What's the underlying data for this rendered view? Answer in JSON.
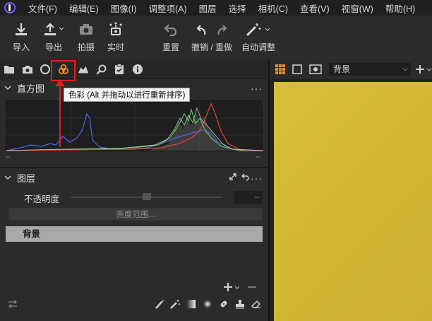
{
  "menubar": {
    "items": [
      "文件(F)",
      "编辑(E)",
      "图像(I)",
      "调整项(A)",
      "图层",
      "选择",
      "相机(C)",
      "查看(V)",
      "视窗(W)",
      "帮助(H)"
    ]
  },
  "toolbar": {
    "import": {
      "label": "导入",
      "icon": "import-icon"
    },
    "export": {
      "label": "导出",
      "icon": "export-icon"
    },
    "capture": {
      "label": "拍摄",
      "icon": "camera-icon"
    },
    "live": {
      "label": "实时",
      "icon": "live-view-icon"
    },
    "reset": {
      "label": "重置",
      "icon": "reset-icon"
    },
    "undo_redo": {
      "label": "撤销 / 重做",
      "icon": "undo-redo-icon"
    },
    "auto_adjust": {
      "label": "自动调整",
      "icon": "magic-wand-icon"
    }
  },
  "tool_tabs": {
    "icons": [
      "folder-icon",
      "camera-icon",
      "lens-icon",
      "color-icon",
      "exposure-icon",
      "search-icon",
      "clipboard-icon",
      "info-icon"
    ],
    "active": "color-icon",
    "tooltip": "色彩 (Alt 并拖动以进行重新排序)"
  },
  "histogram": {
    "title": "直方图",
    "foot_left": "--",
    "foot_right": "--",
    "colors": {
      "red": "#e0413a",
      "green": "#5fc35a",
      "blue": "#5a62e8",
      "luma": "#d9d9d9"
    }
  },
  "layers": {
    "title": "图层",
    "opacity_label": "不透明度",
    "opacity_value": "--",
    "range_button": "亮度范围...",
    "layer_name": "背景"
  },
  "viewer": {
    "selected": "背景",
    "image_color": "#d6bb37"
  },
  "colors": {
    "accent": "#f28c28",
    "highlight": "#e02020"
  }
}
